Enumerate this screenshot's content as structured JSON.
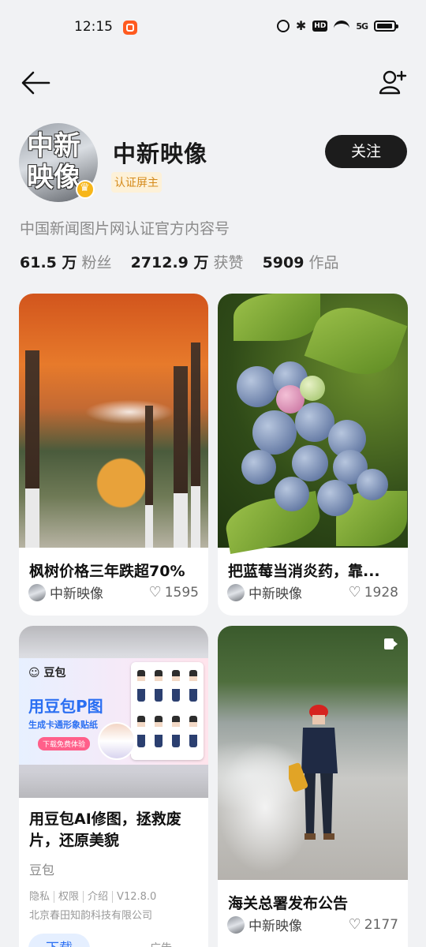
{
  "status": {
    "time": "12:15",
    "hd": "HD",
    "signal": "5G"
  },
  "profile": {
    "name": "中新映像",
    "avatar_text": [
      "中新",
      "映像"
    ],
    "badge": "认证屏主",
    "follow_label": "关注",
    "description": "中国新闻图片网认证官方内容号",
    "stats": [
      {
        "value": "61.5 万",
        "label": "粉丝"
      },
      {
        "value": "2712.9 万",
        "label": "获赞"
      },
      {
        "value": "5909",
        "label": "作品"
      }
    ]
  },
  "cards": [
    {
      "title": "枫树价格三年跌超70%",
      "author": "中新映像",
      "likes": "1595"
    },
    {
      "title": "把蓝莓当消炎药，靠...",
      "author": "中新映像",
      "likes": "1928"
    },
    {
      "title": "海关总署发布公告",
      "author": "中新映像",
      "likes": "2177"
    }
  ],
  "ad": {
    "logo": "豆包",
    "headline": "用豆包P图",
    "sub": "生成卡通形象贴纸",
    "cta": "下载免费体验",
    "title": "用豆包AI修图，拯救废片，还原美貌",
    "brand": "豆包",
    "links": [
      "隐私",
      "权限",
      "介绍",
      "V12.8.0"
    ],
    "company": "北京春田知韵科技有限公司",
    "download_label": "下载",
    "ad_label": "广告"
  }
}
